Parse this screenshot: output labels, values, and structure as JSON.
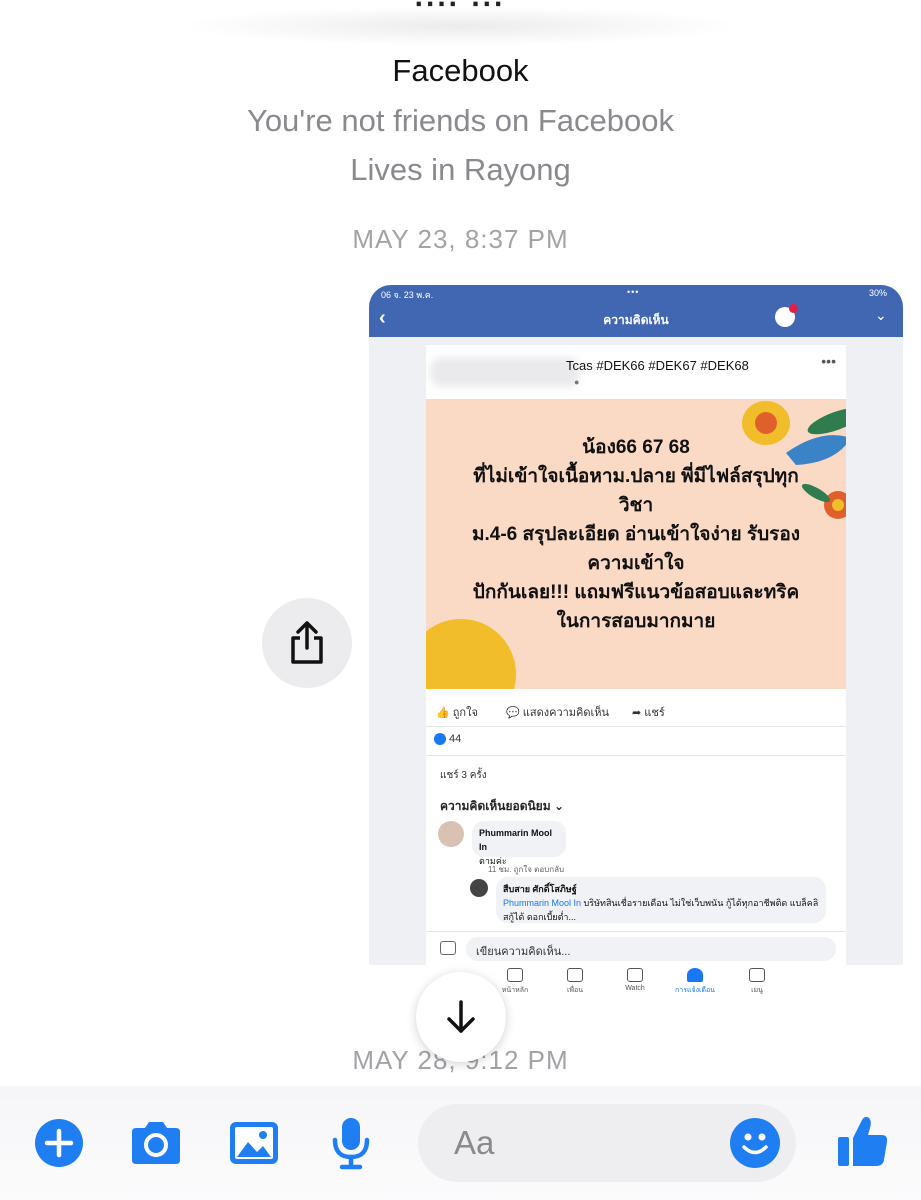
{
  "header": {
    "blurred_name": "∙∙∙∙ ∙∙∙",
    "title": "Facebook",
    "friend_status": "You're not friends on Facebook",
    "location": "Lives in Rayong"
  },
  "timestamps": [
    "MAY 23, 8:37 PM",
    "MAY 28, 9:12 PM"
  ],
  "shared_screenshot": {
    "status_left": "06  จ. 23 พ.ค.",
    "status_center": "•••",
    "status_right": "30%",
    "nav_title": "ความคิดเห็น",
    "post_tags": "Tcas #DEK66 #DEK67 #DEK68",
    "promo_lines": [
      "น้อง66 67 68",
      "ที่ไม่เข้าใจเนื้อหาม.ปลาย พี่มีไฟล์สรุปทุก",
      "วิชา",
      "ม.4-6 สรุปละเอียด อ่านเข้าใจง่าย รับรอง",
      "ความเข้าใจ",
      "ปักกันเลย!!! แถมฟรีแนวข้อสอบและทริค",
      "ในการสอบมากมาย"
    ],
    "actions": {
      "like": "ถูกใจ",
      "comment": "แสดงความคิดเห็น",
      "share": "แชร์"
    },
    "reaction_count": "44",
    "shares": "แชร์ 3 ครั้ง",
    "top_comments": "ความคิดเห็นยอดนิยม",
    "comment1": {
      "name": "Phummarin Mool In",
      "text": "ตามค่ะ",
      "meta": "11 ชม.    ถูกใจ    ตอบกลับ"
    },
    "comment2": {
      "name": "สืบสาย ศักดิ์โสภิษฐ์",
      "mention": "Phummarin Mool In",
      "text": " บริษัทสินเชื่อรายเดือน ไม่ใช่เว็บพนัน กู้ได้ทุกอาชีพติด แบล็คลิสกู้ได้ ดอกเบี้ยต่ำ..."
    },
    "composer_placeholder": "เขียนความคิดเห็น...",
    "tabs": [
      "หน้าหลัก",
      "เพื่อน",
      "Watch",
      "การแจ้งเตือน",
      "เมนู"
    ]
  },
  "composer": {
    "placeholder": "Aa"
  },
  "colors": {
    "messenger_blue": "#1f7ff2",
    "facebook_blue": "#4267b2"
  }
}
